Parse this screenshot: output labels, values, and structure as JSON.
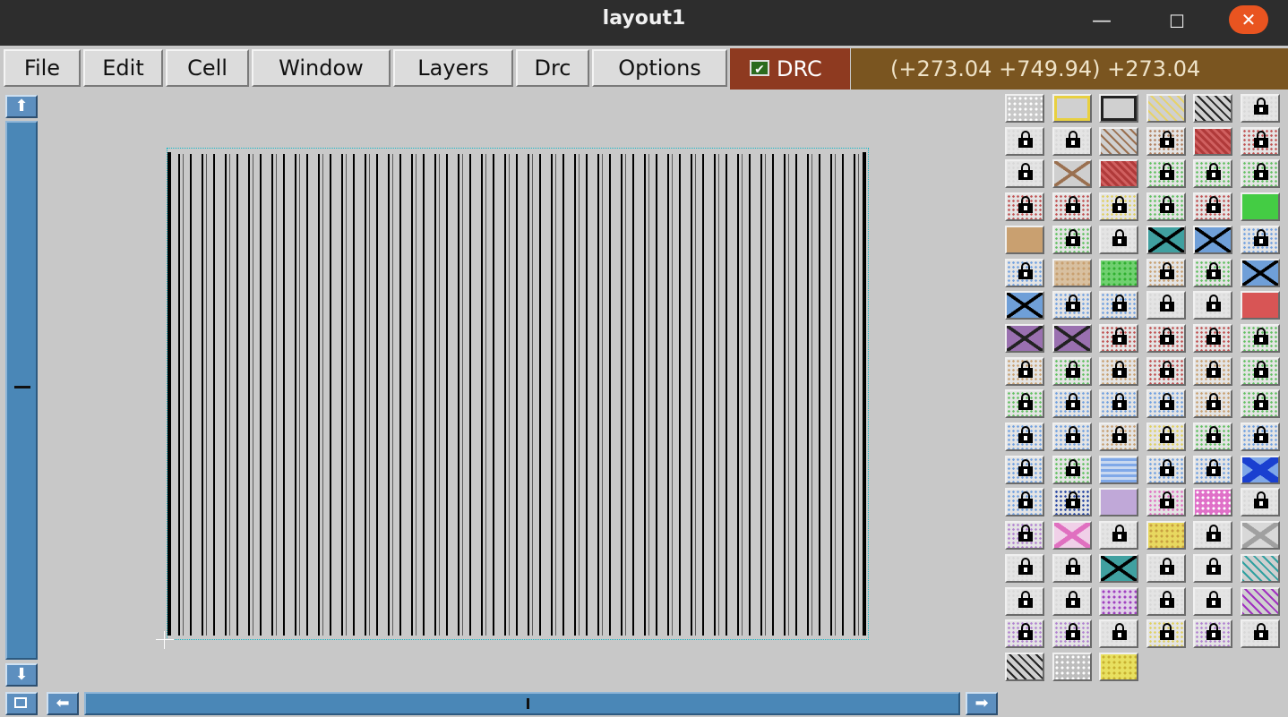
{
  "window": {
    "title": "layout1",
    "minimize": "—",
    "maximize": "☐",
    "close": "✕"
  },
  "menu": {
    "items": [
      {
        "label": "File"
      },
      {
        "label": "Edit"
      },
      {
        "label": "Cell"
      },
      {
        "label": "Window"
      },
      {
        "label": "Layers"
      },
      {
        "label": "Drc"
      },
      {
        "label": "Options"
      }
    ],
    "drc_toggle": {
      "label": "DRC",
      "checked": true,
      "check_glyph": "✔"
    },
    "coordinates": "(+273.04 +749.94) +273.04"
  },
  "scrollbars": {
    "vertical": {
      "up_icon": "arrow-up-icon",
      "down_icon": "arrow-down-icon",
      "up_glyph": "⬆",
      "down_glyph": "⬇"
    },
    "horizontal": {
      "left_icon": "arrow-left-icon",
      "right_icon": "arrow-right-icon",
      "left_glyph": "⬅",
      "right_glyph": "➡"
    }
  },
  "colors": {
    "drc_bg": "#8e3a20",
    "coords_bg": "#7a5520",
    "scroll_blue": "#4a87b7",
    "cell_outline": "#16b8c8"
  },
  "layers": [
    [
      "dots-white",
      "plain-yellow-outline",
      "plain-black-outline",
      "yellow-hatch",
      "black-hatch",
      "lock-gray"
    ],
    [
      "lock-gray",
      "lock-gray",
      "brown-hatch",
      "lock-brown",
      "red-hatch",
      "lock-red"
    ],
    [
      "lock-gray",
      "brown-cross",
      "red-hatch",
      "lock-green",
      "lock-green",
      "lock-green"
    ],
    [
      "lock-red",
      "lock-red",
      "lock-yellow",
      "lock-green",
      "lock-red",
      "solid-green"
    ],
    [
      "solid-tan",
      "lock-green",
      "lock-gray",
      "teal-x",
      "blue-x",
      "lock-blue"
    ],
    [
      "lock-blue",
      "tan-dots",
      "green-dots",
      "lock-tan",
      "lock-green",
      "blue-x"
    ],
    [
      "blue-x",
      "lock-blue",
      "lock-blue",
      "lock-gray",
      "lock-gray",
      "solid-red"
    ],
    [
      "purple-x",
      "purple-x",
      "lock-red",
      "lock-red",
      "lock-red",
      "lock-green"
    ],
    [
      "lock-tan",
      "lock-green",
      "lock-tan",
      "lock-red",
      "lock-tan",
      "lock-green"
    ],
    [
      "lock-green",
      "lock-blue",
      "lock-blue",
      "lock-blue",
      "lock-tan",
      "lock-green"
    ],
    [
      "lock-blue",
      "lock-blue",
      "lock-tan",
      "lock-yellow",
      "lock-green",
      "lock-blue"
    ],
    [
      "lock-blue",
      "lock-green",
      "blue-wave",
      "lock-blue",
      "lock-blue",
      "blue-diamond"
    ],
    [
      "lock-blue",
      "lock-darkblue",
      "lavender",
      "lock-pink",
      "pink-dots",
      "lock-gray"
    ],
    [
      "lock-purple",
      "pink-x",
      "lock-gray",
      "yellow-dots",
      "lock-gray",
      "gray-x"
    ],
    [
      "lock-gray",
      "lock-gray",
      "teal-cross",
      "lock-gray",
      "lock-dotted",
      "teal-hatch"
    ],
    [
      "lock-gray",
      "lock-gray",
      "purple-dots",
      "lock-gray",
      "lock-dotted",
      "purple-hatch"
    ],
    [
      "lock-purple",
      "lock-purple",
      "lock-gray",
      "lock-yellow",
      "lock-purple",
      "lock-gray"
    ],
    [
      "black-hatch-2",
      "white-dots",
      "yellow-dots-2"
    ]
  ]
}
